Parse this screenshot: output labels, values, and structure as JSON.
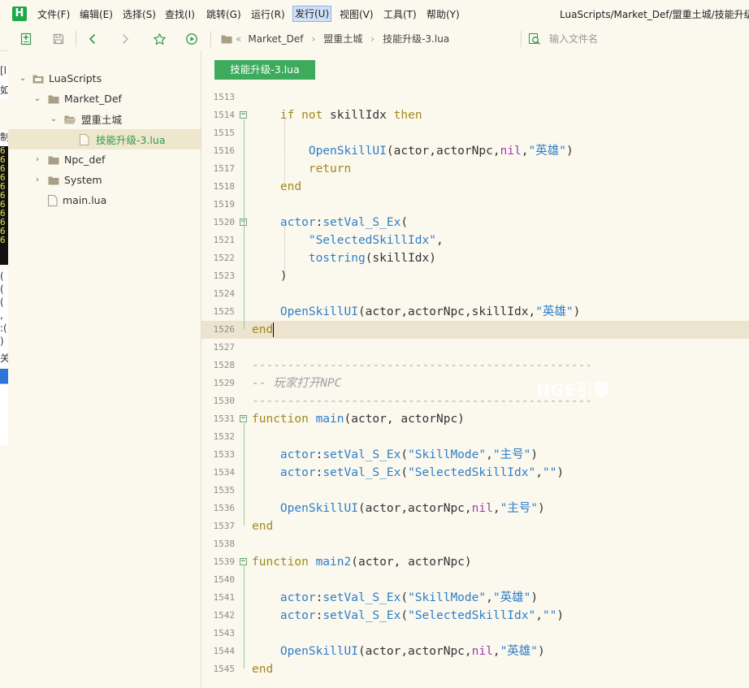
{
  "app": {
    "logo": "H",
    "title": "LuaScripts/Market_Def/盟重土城/技能升级"
  },
  "menu": [
    {
      "label": "文件(F)"
    },
    {
      "label": "编辑(E)"
    },
    {
      "label": "选择(S)"
    },
    {
      "label": "查找(I)"
    },
    {
      "label": "跳转(G)"
    },
    {
      "label": "运行(R)"
    },
    {
      "label": "发行(U)",
      "active": true
    },
    {
      "label": "视图(V)"
    },
    {
      "label": "工具(T)"
    },
    {
      "label": "帮助(Y)"
    }
  ],
  "toolbar": {
    "icons": [
      "new-file-icon",
      "save-icon",
      "back-icon",
      "forward-icon",
      "favorite-star-icon",
      "run-icon"
    ],
    "breadcrumb": [
      "Market_Def",
      "盟重土城",
      "技能升级-3.lua"
    ],
    "file_search_placeholder": "输入文件名"
  },
  "sidebar": {
    "tree": [
      {
        "label": "LuaScripts",
        "depth": 0,
        "type": "root",
        "expanded": true
      },
      {
        "label": "Market_Def",
        "depth": 1,
        "type": "folder",
        "expanded": true
      },
      {
        "label": "盟重土城",
        "depth": 2,
        "type": "folder-open",
        "expanded": true
      },
      {
        "label": "技能升级-3.lua",
        "depth": 3,
        "type": "file",
        "selected": true
      },
      {
        "label": "Npc_def",
        "depth": 1,
        "type": "folder",
        "expanded": false
      },
      {
        "label": "System",
        "depth": 1,
        "type": "folder",
        "expanded": false
      },
      {
        "label": "main.lua",
        "depth": 1,
        "type": "file"
      }
    ]
  },
  "editor": {
    "tab_label": "技能升级-3.lua",
    "watermark": "HGE引擎",
    "current_line": "1526",
    "lines": [
      {
        "n": "1513",
        "tokens": []
      },
      {
        "n": "1514",
        "fold": true,
        "tokens": [
          [
            "plain",
            "    "
          ],
          [
            "kw",
            "if"
          ],
          [
            "plain",
            " "
          ],
          [
            "kw",
            "not"
          ],
          [
            "plain",
            " skillIdx "
          ],
          [
            "kw",
            "then"
          ]
        ]
      },
      {
        "n": "1515",
        "tokens": []
      },
      {
        "n": "1516",
        "tokens": [
          [
            "plain",
            "        "
          ],
          [
            "fn",
            "OpenSkillUI"
          ],
          [
            "plain",
            "(actor,actorNpc,"
          ],
          [
            "nil",
            "nil"
          ],
          [
            "plain",
            ","
          ],
          [
            "str",
            "\"英雄\""
          ],
          [
            "plain",
            ")"
          ]
        ]
      },
      {
        "n": "1517",
        "tokens": [
          [
            "plain",
            "        "
          ],
          [
            "kw",
            "return"
          ]
        ]
      },
      {
        "n": "1518",
        "tokens": [
          [
            "plain",
            "    "
          ],
          [
            "kw",
            "end"
          ]
        ]
      },
      {
        "n": "1519",
        "tokens": []
      },
      {
        "n": "1520",
        "fold": true,
        "tokens": [
          [
            "plain",
            "    "
          ],
          [
            "fn",
            "actor"
          ],
          [
            "plain",
            ":"
          ],
          [
            "fn",
            "setVal_S_Ex"
          ],
          [
            "plain",
            "("
          ]
        ]
      },
      {
        "n": "1521",
        "tokens": [
          [
            "plain",
            "        "
          ],
          [
            "str",
            "\"SelectedSkillIdx\""
          ],
          [
            "plain",
            ","
          ]
        ]
      },
      {
        "n": "1522",
        "tokens": [
          [
            "plain",
            "        "
          ],
          [
            "fn",
            "tostring"
          ],
          [
            "plain",
            "(skillIdx)"
          ]
        ]
      },
      {
        "n": "1523",
        "tokens": [
          [
            "plain",
            "    )"
          ]
        ]
      },
      {
        "n": "1524",
        "tokens": []
      },
      {
        "n": "1525",
        "tokens": [
          [
            "plain",
            "    "
          ],
          [
            "fn",
            "OpenSkillUI"
          ],
          [
            "plain",
            "(actor,actorNpc,skillIdx,"
          ],
          [
            "str",
            "\"英雄\""
          ],
          [
            "plain",
            ")"
          ]
        ]
      },
      {
        "n": "1526",
        "tokens": [
          [
            "kw",
            "end"
          ]
        ]
      },
      {
        "n": "1527",
        "tokens": []
      },
      {
        "n": "1528",
        "tokens": [
          [
            "dash",
            "------------------------------------------------"
          ]
        ]
      },
      {
        "n": "1529",
        "tokens": [
          [
            "cmt",
            "-- 玩家打开NPC"
          ]
        ]
      },
      {
        "n": "1530",
        "tokens": [
          [
            "dash",
            "------------------------------------------------"
          ]
        ]
      },
      {
        "n": "1531",
        "fold": true,
        "tokens": [
          [
            "kw",
            "function"
          ],
          [
            "plain",
            " "
          ],
          [
            "fn",
            "main"
          ],
          [
            "plain",
            "(actor, actorNpc)"
          ]
        ]
      },
      {
        "n": "1532",
        "tokens": []
      },
      {
        "n": "1533",
        "tokens": [
          [
            "plain",
            "    "
          ],
          [
            "fn",
            "actor"
          ],
          [
            "plain",
            ":"
          ],
          [
            "fn",
            "setVal_S_Ex"
          ],
          [
            "plain",
            "("
          ],
          [
            "str",
            "\"SkillMode\""
          ],
          [
            "plain",
            ","
          ],
          [
            "str",
            "\"主号\""
          ],
          [
            "plain",
            ")"
          ]
        ]
      },
      {
        "n": "1534",
        "tokens": [
          [
            "plain",
            "    "
          ],
          [
            "fn",
            "actor"
          ],
          [
            "plain",
            ":"
          ],
          [
            "fn",
            "setVal_S_Ex"
          ],
          [
            "plain",
            "("
          ],
          [
            "str",
            "\"SelectedSkillIdx\""
          ],
          [
            "plain",
            ","
          ],
          [
            "str",
            "\"\""
          ],
          [
            "plain",
            ")"
          ]
        ]
      },
      {
        "n": "1535",
        "tokens": []
      },
      {
        "n": "1536",
        "tokens": [
          [
            "plain",
            "    "
          ],
          [
            "fn",
            "OpenSkillUI"
          ],
          [
            "plain",
            "(actor,actorNpc,"
          ],
          [
            "nil",
            "nil"
          ],
          [
            "plain",
            ","
          ],
          [
            "str",
            "\"主号\""
          ],
          [
            "plain",
            ")"
          ]
        ]
      },
      {
        "n": "1537",
        "tokens": [
          [
            "kw",
            "end"
          ]
        ]
      },
      {
        "n": "1538",
        "tokens": []
      },
      {
        "n": "1539",
        "fold": true,
        "tokens": [
          [
            "kw",
            "function"
          ],
          [
            "plain",
            " "
          ],
          [
            "fn",
            "main2"
          ],
          [
            "plain",
            "(actor, actorNpc)"
          ]
        ]
      },
      {
        "n": "1540",
        "tokens": []
      },
      {
        "n": "1541",
        "tokens": [
          [
            "plain",
            "    "
          ],
          [
            "fn",
            "actor"
          ],
          [
            "plain",
            ":"
          ],
          [
            "fn",
            "setVal_S_Ex"
          ],
          [
            "plain",
            "("
          ],
          [
            "str",
            "\"SkillMode\""
          ],
          [
            "plain",
            ","
          ],
          [
            "str",
            "\"英雄\""
          ],
          [
            "plain",
            ")"
          ]
        ]
      },
      {
        "n": "1542",
        "tokens": [
          [
            "plain",
            "    "
          ],
          [
            "fn",
            "actor"
          ],
          [
            "plain",
            ":"
          ],
          [
            "fn",
            "setVal_S_Ex"
          ],
          [
            "plain",
            "("
          ],
          [
            "str",
            "\"SelectedSkillIdx\""
          ],
          [
            "plain",
            ","
          ],
          [
            "str",
            "\"\""
          ],
          [
            "plain",
            ")"
          ]
        ]
      },
      {
        "n": "1543",
        "tokens": []
      },
      {
        "n": "1544",
        "tokens": [
          [
            "plain",
            "    "
          ],
          [
            "fn",
            "OpenSkillUI"
          ],
          [
            "plain",
            "(actor,actorNpc,"
          ],
          [
            "nil",
            "nil"
          ],
          [
            "plain",
            ","
          ],
          [
            "str",
            "\"英雄\""
          ],
          [
            "plain",
            ")"
          ]
        ]
      },
      {
        "n": "1545",
        "tokens": [
          [
            "kw",
            "end"
          ]
        ]
      }
    ]
  },
  "background_window": {
    "fragments": [
      "[l",
      "如",
      "制",
      "6",
      "6",
      "6",
      "6",
      "6",
      "6",
      "6",
      "6",
      "6",
      "6",
      "6",
      "(",
      "(",
      "(",
      ",",
      ":(",
      ")",
      "关"
    ]
  },
  "colors": {
    "accent_green": "#3daa5c",
    "keyword": "#a0891c",
    "function": "#2e7ec8",
    "nil": "#9b3fa8",
    "comment": "#a0a0a0",
    "background": "#fbf8ee"
  }
}
